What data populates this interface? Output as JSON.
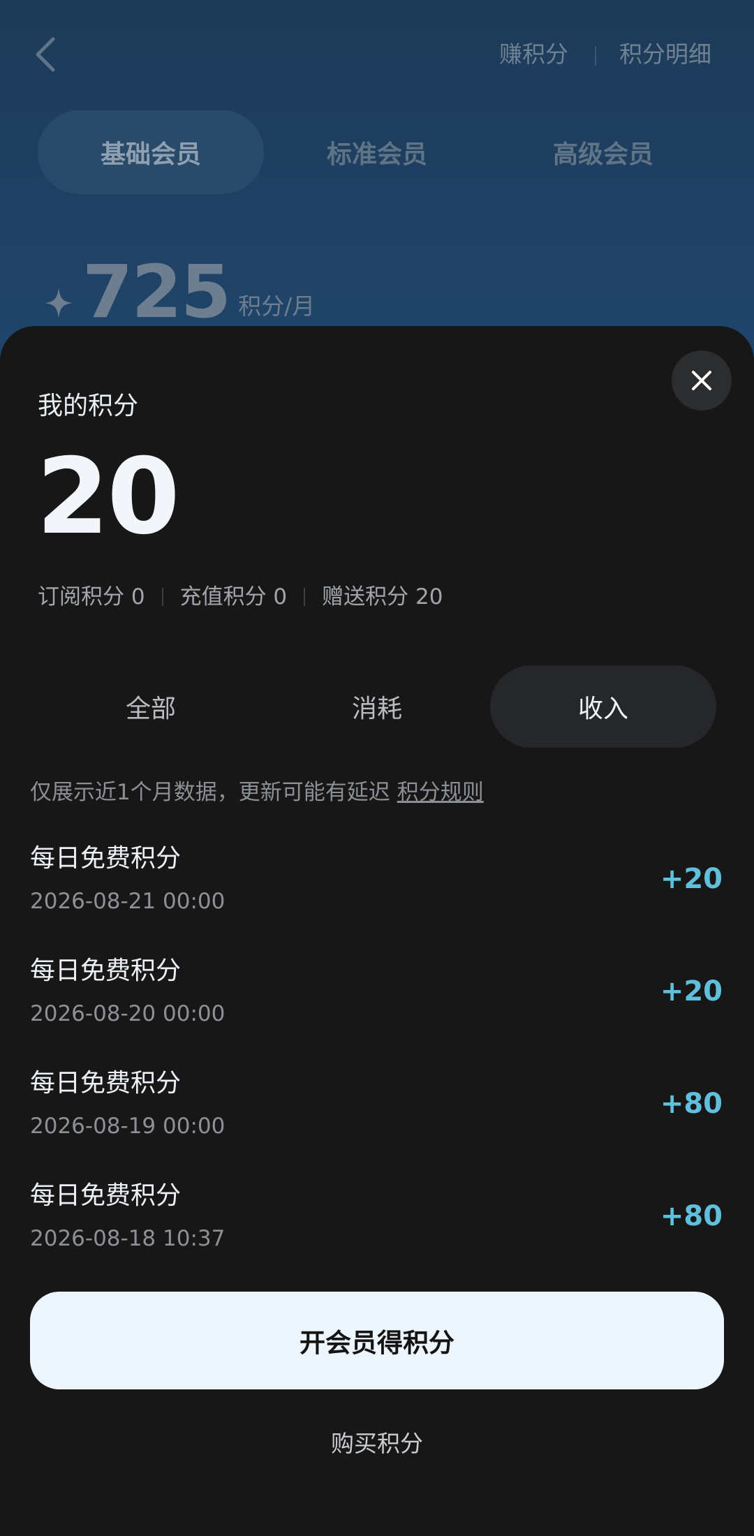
{
  "header": {
    "earn_points": "赚积分",
    "points_detail": "积分明细"
  },
  "tiers": [
    {
      "label": "基础会员",
      "active": true
    },
    {
      "label": "标准会员",
      "active": false
    },
    {
      "label": "高级会员",
      "active": false
    }
  ],
  "plan": {
    "points": "725",
    "unit": "积分/月"
  },
  "sheet": {
    "title": "我的积分",
    "balance": "20",
    "breakdown": {
      "subscription": "订阅积分 0",
      "recharge": "充值积分 0",
      "gift": "赠送积分 20"
    },
    "filters": [
      {
        "label": "全部",
        "active": false
      },
      {
        "label": "消耗",
        "active": false
      },
      {
        "label": "收入",
        "active": true
      }
    ],
    "notice": "仅展示近1个月数据，更新可能有延迟",
    "rules_link": "积分规则",
    "records": [
      {
        "title": "每日免费积分",
        "time": "2026-08-21 00:00",
        "amount": "+20"
      },
      {
        "title": "每日免费积分",
        "time": "2026-08-20 00:00",
        "amount": "+20"
      },
      {
        "title": "每日免费积分",
        "time": "2026-08-19 00:00",
        "amount": "+80"
      },
      {
        "title": "每日免费积分",
        "time": "2026-08-18 10:37",
        "amount": "+80"
      }
    ],
    "primary_button": "开会员得积分",
    "secondary_link": "购买积分"
  },
  "colors": {
    "sheet_bg": "#171717",
    "accent_amount": "#5fbfdc",
    "primary_button_bg": "#eef6fd",
    "backdrop": "#1e3d5c"
  },
  "icons": {
    "back": "chevron-left-icon",
    "close": "close-icon",
    "points": "sparkle-icon"
  }
}
